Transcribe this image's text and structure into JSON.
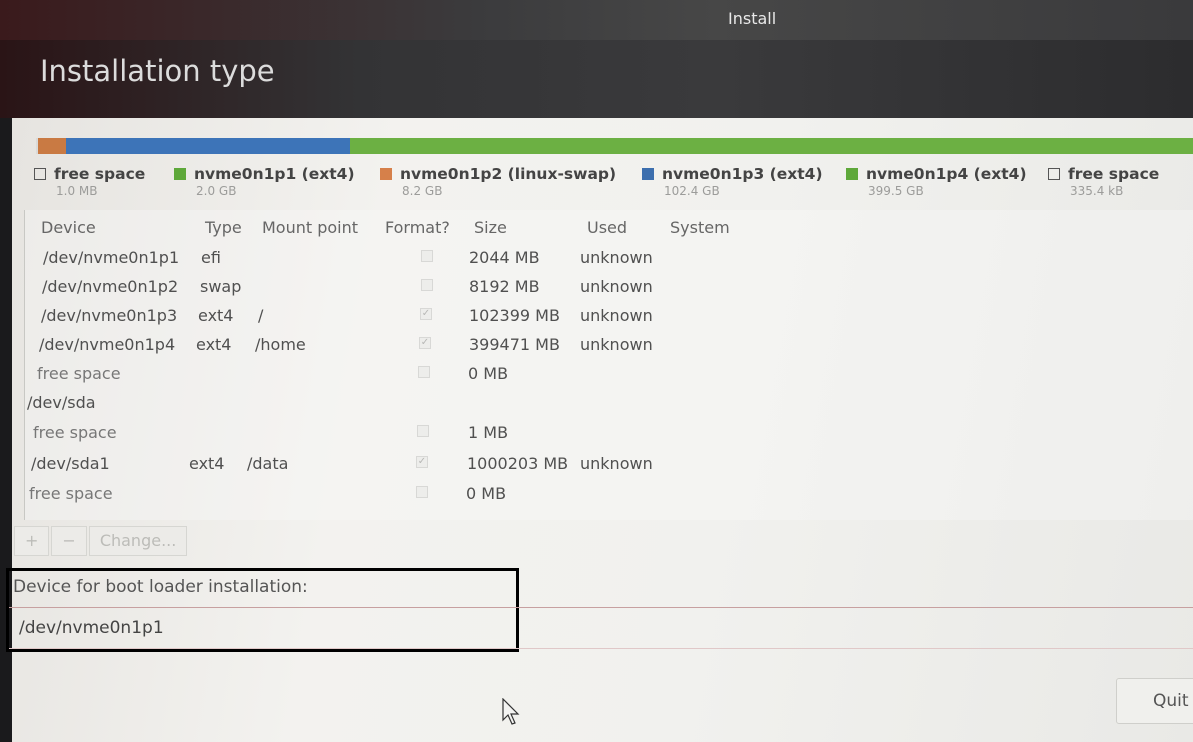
{
  "window": {
    "title": "Install"
  },
  "page": {
    "title": "Installation type"
  },
  "colors": {
    "free": "#e8e8e6",
    "efi": "#c97a43",
    "swap": "#d07a44",
    "root": "#3d74b8",
    "home": "#6cb043"
  },
  "partition_bar": [
    {
      "name": "free space",
      "color": "#dadad8",
      "fraction": 0.002
    },
    {
      "name": "nvme0n1p1",
      "color": "#c97a43",
      "fraction": 0.008
    },
    {
      "name": "nvme0n1p2",
      "color": "#c97a43",
      "fraction": 0.016
    },
    {
      "name": "nvme0n1p3",
      "color": "#3d74b8",
      "fraction": 0.245
    },
    {
      "name": "nvme0n1p4",
      "color": "#6cb043",
      "fraction": 0.729
    }
  ],
  "legend": [
    {
      "label": "free space",
      "size": "1.0 MB",
      "swatch": "empty"
    },
    {
      "label": "nvme0n1p1 (ext4)",
      "size": "2.0 GB",
      "swatch": "#5ea83a"
    },
    {
      "label": "nvme0n1p2 (linux-swap)",
      "size": "8.2 GB",
      "swatch": "#d6804a"
    },
    {
      "label": "nvme0n1p3 (ext4)",
      "size": "102.4 GB",
      "swatch": "#3d6fae"
    },
    {
      "label": "nvme0n1p4 (ext4)",
      "size": "399.5 GB",
      "swatch": "#5ea83a"
    },
    {
      "label": "free space",
      "size": "335.4 kB",
      "swatch": "empty"
    }
  ],
  "table": {
    "headers": [
      "Device",
      "Type",
      "Mount point",
      "Format?",
      "Size",
      "Used",
      "System"
    ],
    "rows": [
      {
        "device": "/dev/nvme0n1p1",
        "type": "efi",
        "mount": "",
        "format": false,
        "size": "2044 MB",
        "used": "unknown"
      },
      {
        "device": "/dev/nvme0n1p2",
        "type": "swap",
        "mount": "",
        "format": false,
        "size": "8192 MB",
        "used": "unknown"
      },
      {
        "device": "/dev/nvme0n1p3",
        "type": "ext4",
        "mount": "/",
        "format": true,
        "size": "102399 MB",
        "used": "unknown"
      },
      {
        "device": "/dev/nvme0n1p4",
        "type": "ext4",
        "mount": "/home",
        "format": true,
        "size": "399471 MB",
        "used": "unknown"
      },
      {
        "device": "free space",
        "type": "",
        "mount": "",
        "format": false,
        "size": "0 MB",
        "used": ""
      },
      {
        "device": "/dev/sda",
        "type": "",
        "mount": "",
        "format": null,
        "size": "",
        "used": ""
      },
      {
        "device": "free space",
        "type": "",
        "mount": "",
        "format": false,
        "size": "1 MB",
        "used": ""
      },
      {
        "device": "/dev/sda1",
        "type": "ext4",
        "mount": "/data",
        "format": true,
        "size": "1000203 MB",
        "used": "unknown"
      },
      {
        "device": "free space",
        "type": "",
        "mount": "",
        "format": false,
        "size": "0 MB",
        "used": ""
      }
    ]
  },
  "toolbar": {
    "add": "+",
    "remove": "−",
    "change": "Change..."
  },
  "boot_loader": {
    "label": "Device for boot loader installation:",
    "value": "/dev/nvme0n1p1"
  },
  "buttons": {
    "quit": "Quit"
  }
}
